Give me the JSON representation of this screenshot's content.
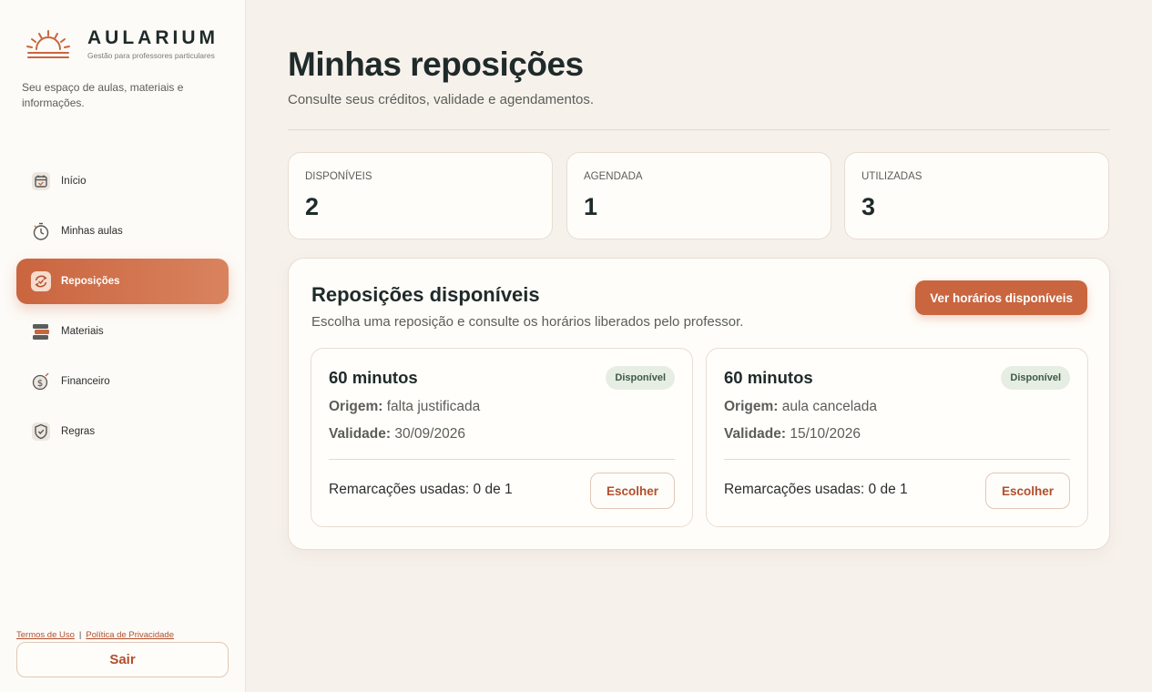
{
  "brand": {
    "name": "AULARIUM",
    "subtitle": "Gestão para professores particulares",
    "tagline": "Seu espaço de aulas, materiais e informações.",
    "accent_color": "#c9653f"
  },
  "sidebar": {
    "items": [
      {
        "label": "Início",
        "icon": "calendar-icon",
        "active": false
      },
      {
        "label": "Minhas aulas",
        "icon": "stopwatch-icon",
        "active": false
      },
      {
        "label": "Reposições",
        "icon": "refresh-check-icon",
        "active": true
      },
      {
        "label": "Materiais",
        "icon": "books-icon",
        "active": false
      },
      {
        "label": "Financeiro",
        "icon": "dollar-coin-icon",
        "active": false
      },
      {
        "label": "Regras",
        "icon": "shield-check-icon",
        "active": false
      }
    ],
    "terms_link": "Termos de Uso",
    "separator": "|",
    "privacy_link": "Política de Privacidade",
    "logout_label": "Sair"
  },
  "header": {
    "title": "Minhas reposições",
    "subtitle": "Consulte seus créditos, validade e agendamentos."
  },
  "stats": [
    {
      "label": "DISPONÍVEIS",
      "value": "2"
    },
    {
      "label": "AGENDADA",
      "value": "1"
    },
    {
      "label": "UTILIZADAS",
      "value": "3"
    }
  ],
  "panel": {
    "title": "Reposições disponíveis",
    "subtitle": "Escolha uma reposição e consulte os horários liberados pelo professor.",
    "cta_label": "Ver horários disponíveis",
    "cards": [
      {
        "duration": "60 minutos",
        "status": "Disponível",
        "origin_label": "Origem:",
        "origin_value": "falta justificada",
        "validity_label": "Validade:",
        "validity_value": "30/09/2026",
        "usage": "Remarcações usadas: 0 de 1",
        "choose_label": "Escolher"
      },
      {
        "duration": "60 minutos",
        "status": "Disponível",
        "origin_label": "Origem:",
        "origin_value": "aula cancelada",
        "validity_label": "Validade:",
        "validity_value": "15/10/2026",
        "usage": "Remarcações usadas: 0 de 1",
        "choose_label": "Escolher"
      }
    ]
  }
}
